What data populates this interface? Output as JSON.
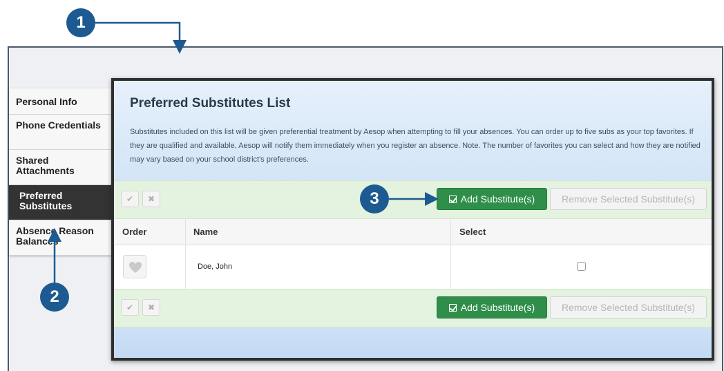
{
  "sidebar": {
    "items": [
      {
        "label": "Personal Info"
      },
      {
        "label": "Phone Credentials"
      },
      {
        "label": "Shared Attachments"
      },
      {
        "label": "Preferred Substitutes"
      },
      {
        "label": "Absence Reason Balances"
      }
    ]
  },
  "panel": {
    "title": "Preferred Substitutes List",
    "description": "Substitutes included on this list will be given preferential treatment by Aesop when attempting to fill your absences. You can order up to five subs as your top favorites. If they are qualified and available, Aesop will notify them immediately when you register an absence. Note. The number of favorites you can select and how they are notified may vary based on your school district's preferences."
  },
  "toolbar": {
    "check_label": "✔",
    "close_label": "✖",
    "add_label": "Add Substitute(s)",
    "remove_label": "Remove Selected Substitute(s)"
  },
  "table": {
    "columns": [
      "Order",
      "Name",
      "Select"
    ],
    "rows": [
      {
        "name": "Doe, John",
        "selected": false
      }
    ]
  },
  "callouts": [
    "1",
    "2",
    "3"
  ],
  "colors": {
    "primary": "#2f8f4a",
    "marker": "#1d5a91",
    "active_sidebar": "#333333"
  }
}
